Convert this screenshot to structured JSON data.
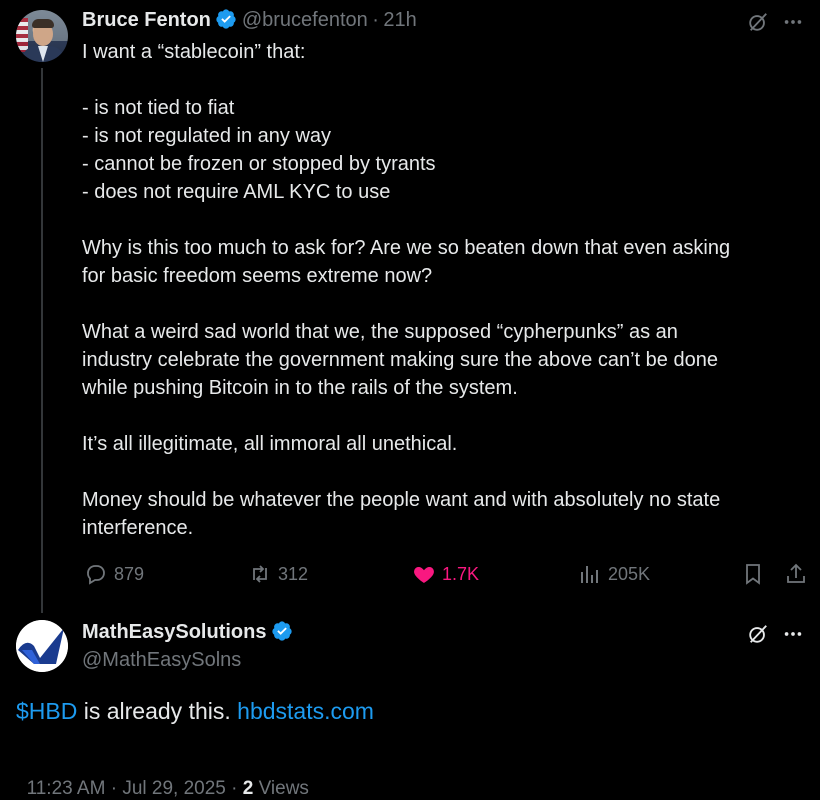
{
  "tweet": {
    "author_name": "Bruce Fenton",
    "handle": "@brucefenton",
    "sep": "·",
    "time": "21h",
    "paragraphs": [
      [
        "I want a “stablecoin” that:"
      ],
      [
        "- is not tied to fiat",
        "- is not regulated in any way",
        "- cannot be frozen or stopped by tyrants",
        "- does not require AML KYC to use"
      ],
      [
        "Why is this too much to ask for?  Are we so beaten down that even asking",
        "for basic freedom seems extreme now?"
      ],
      [
        "What a weird sad world that we, the supposed “cypherpunks” as an",
        "industry celebrate the government making sure the above can’t be done",
        "while pushing Bitcoin in to the rails of the system."
      ],
      [
        "It’s all illegitimate, all immoral all unethical."
      ],
      [
        "Money should be whatever the people want and with absolutely no state",
        "interference."
      ]
    ],
    "stats": {
      "replies": "879",
      "retweets": "312",
      "likes": "1.7K",
      "views": "205K"
    },
    "like_color": "#f91880"
  },
  "reply": {
    "author_name": "MathEasySolutions",
    "handle": "@MathEasySolns",
    "cashtag": "$HBD",
    "text_middle": " is already this. ",
    "link": "hbdstats.com",
    "time": "11:23 AM · Jul 29, 2025 · ",
    "views_count": "2",
    "views_label": " Views"
  },
  "colors": {
    "accent": "#1d9bf0",
    "muted": "#71767b",
    "text": "#e7e9ea",
    "background": "#000000"
  }
}
